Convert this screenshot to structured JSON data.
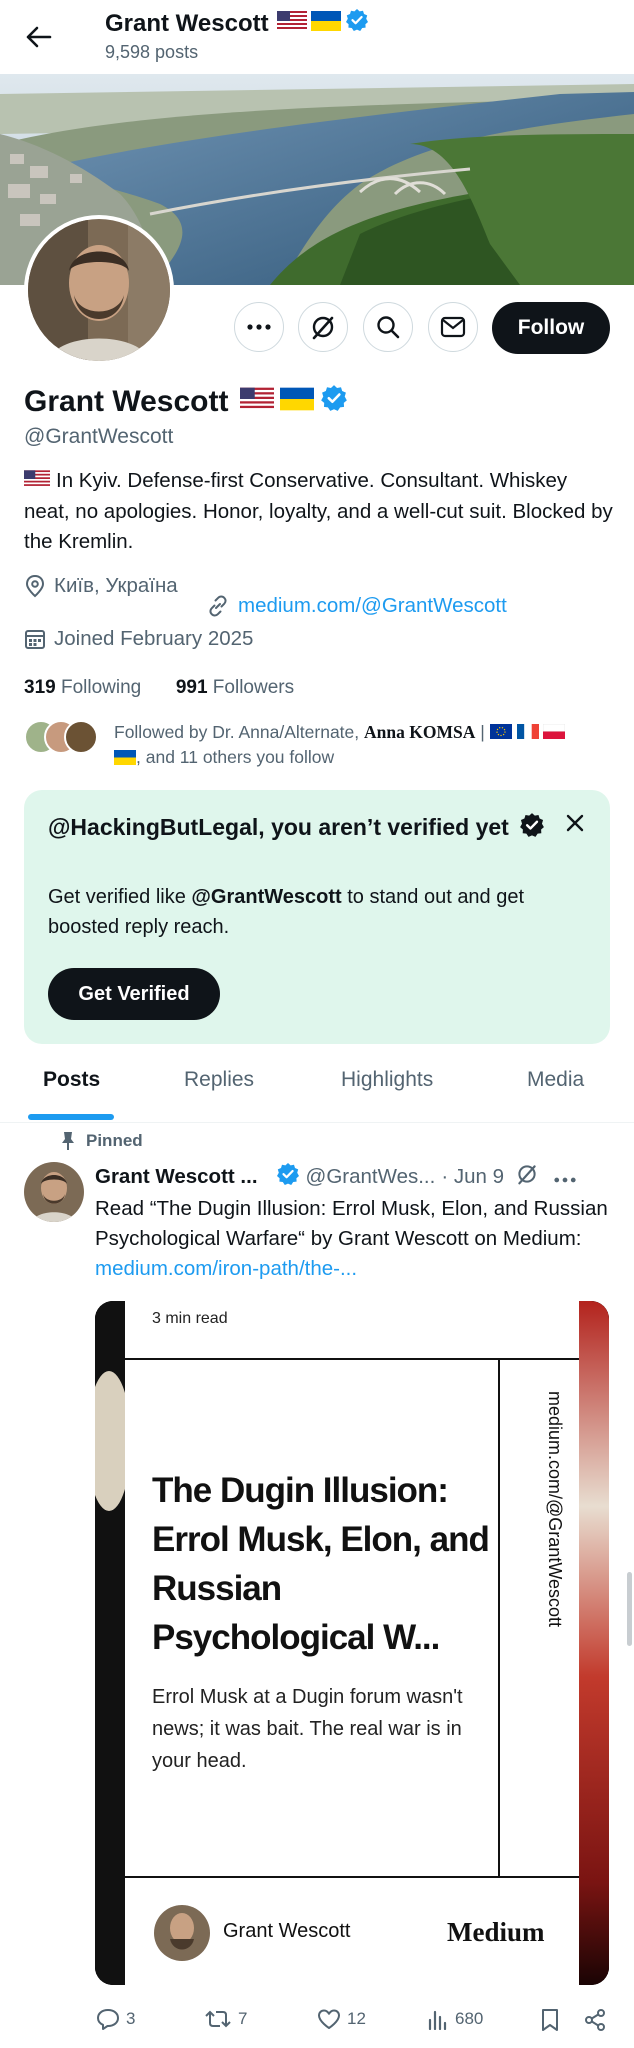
{
  "header": {
    "name": "Grant Wescott",
    "posts_count": "9,598 posts"
  },
  "profile": {
    "name": "Grant Wescott",
    "handle": "@GrantWescott",
    "bio": "In Kyiv. Defense-first Conservative. Consultant. Whiskey neat, no apologies. Honor, loyalty, and a well-cut suit. Blocked by the Kremlin.",
    "location": "Київ, Україна",
    "website": "medium.com/@GrantWescott",
    "joined": "Joined February 2025",
    "following_count": "319",
    "following_label": "Following",
    "followers_count": "991",
    "followers_label": "Followers",
    "followed_by_prefix": "Followed by Dr. Anna/Alternate,",
    "followed_by_name2": "Anna KOMSA",
    "followed_by_sep": "|",
    "followed_by_suffix": ", and 11 others you follow",
    "follow_button": "Follow"
  },
  "verify_card": {
    "title": "@HackingButLegal, you aren’t verified yet",
    "text_prefix": "Get verified like",
    "text_bold": "@GrantWescott",
    "text_suffix": "to stand out and get boosted reply reach.",
    "button": "Get Verified"
  },
  "tabs": [
    "Posts",
    "Replies",
    "Highlights",
    "Media"
  ],
  "post": {
    "pinned_label": "Pinned",
    "author": "Grant Wescott ...",
    "handle": "@GrantWes...",
    "date": "· Jun 9",
    "text": "Read “The Dugin Illusion: Errol Musk, Elon, and Russian Psychological Warfare“ by Grant Wescott on Medium:",
    "link": "medium.com/iron-path/the-...",
    "card": {
      "read_time": "3 min read",
      "headline": "The Dugin Illusion: Errol Musk, Elon, and Russian Psychological W...",
      "subtitle": "Errol Musk at a Dugin forum wasn't news; it was bait. The real war is in your head.",
      "side_text": "medium.com/@GrantWescott",
      "author": "Grant Wescott",
      "brand": "Medium"
    },
    "replies": "3",
    "reposts": "7",
    "likes": "12",
    "views": "680"
  },
  "colors": {
    "accent": "#1d9bf0",
    "verify_bg": "#dff6ec",
    "text": "#0f1419",
    "muted": "#536471"
  }
}
